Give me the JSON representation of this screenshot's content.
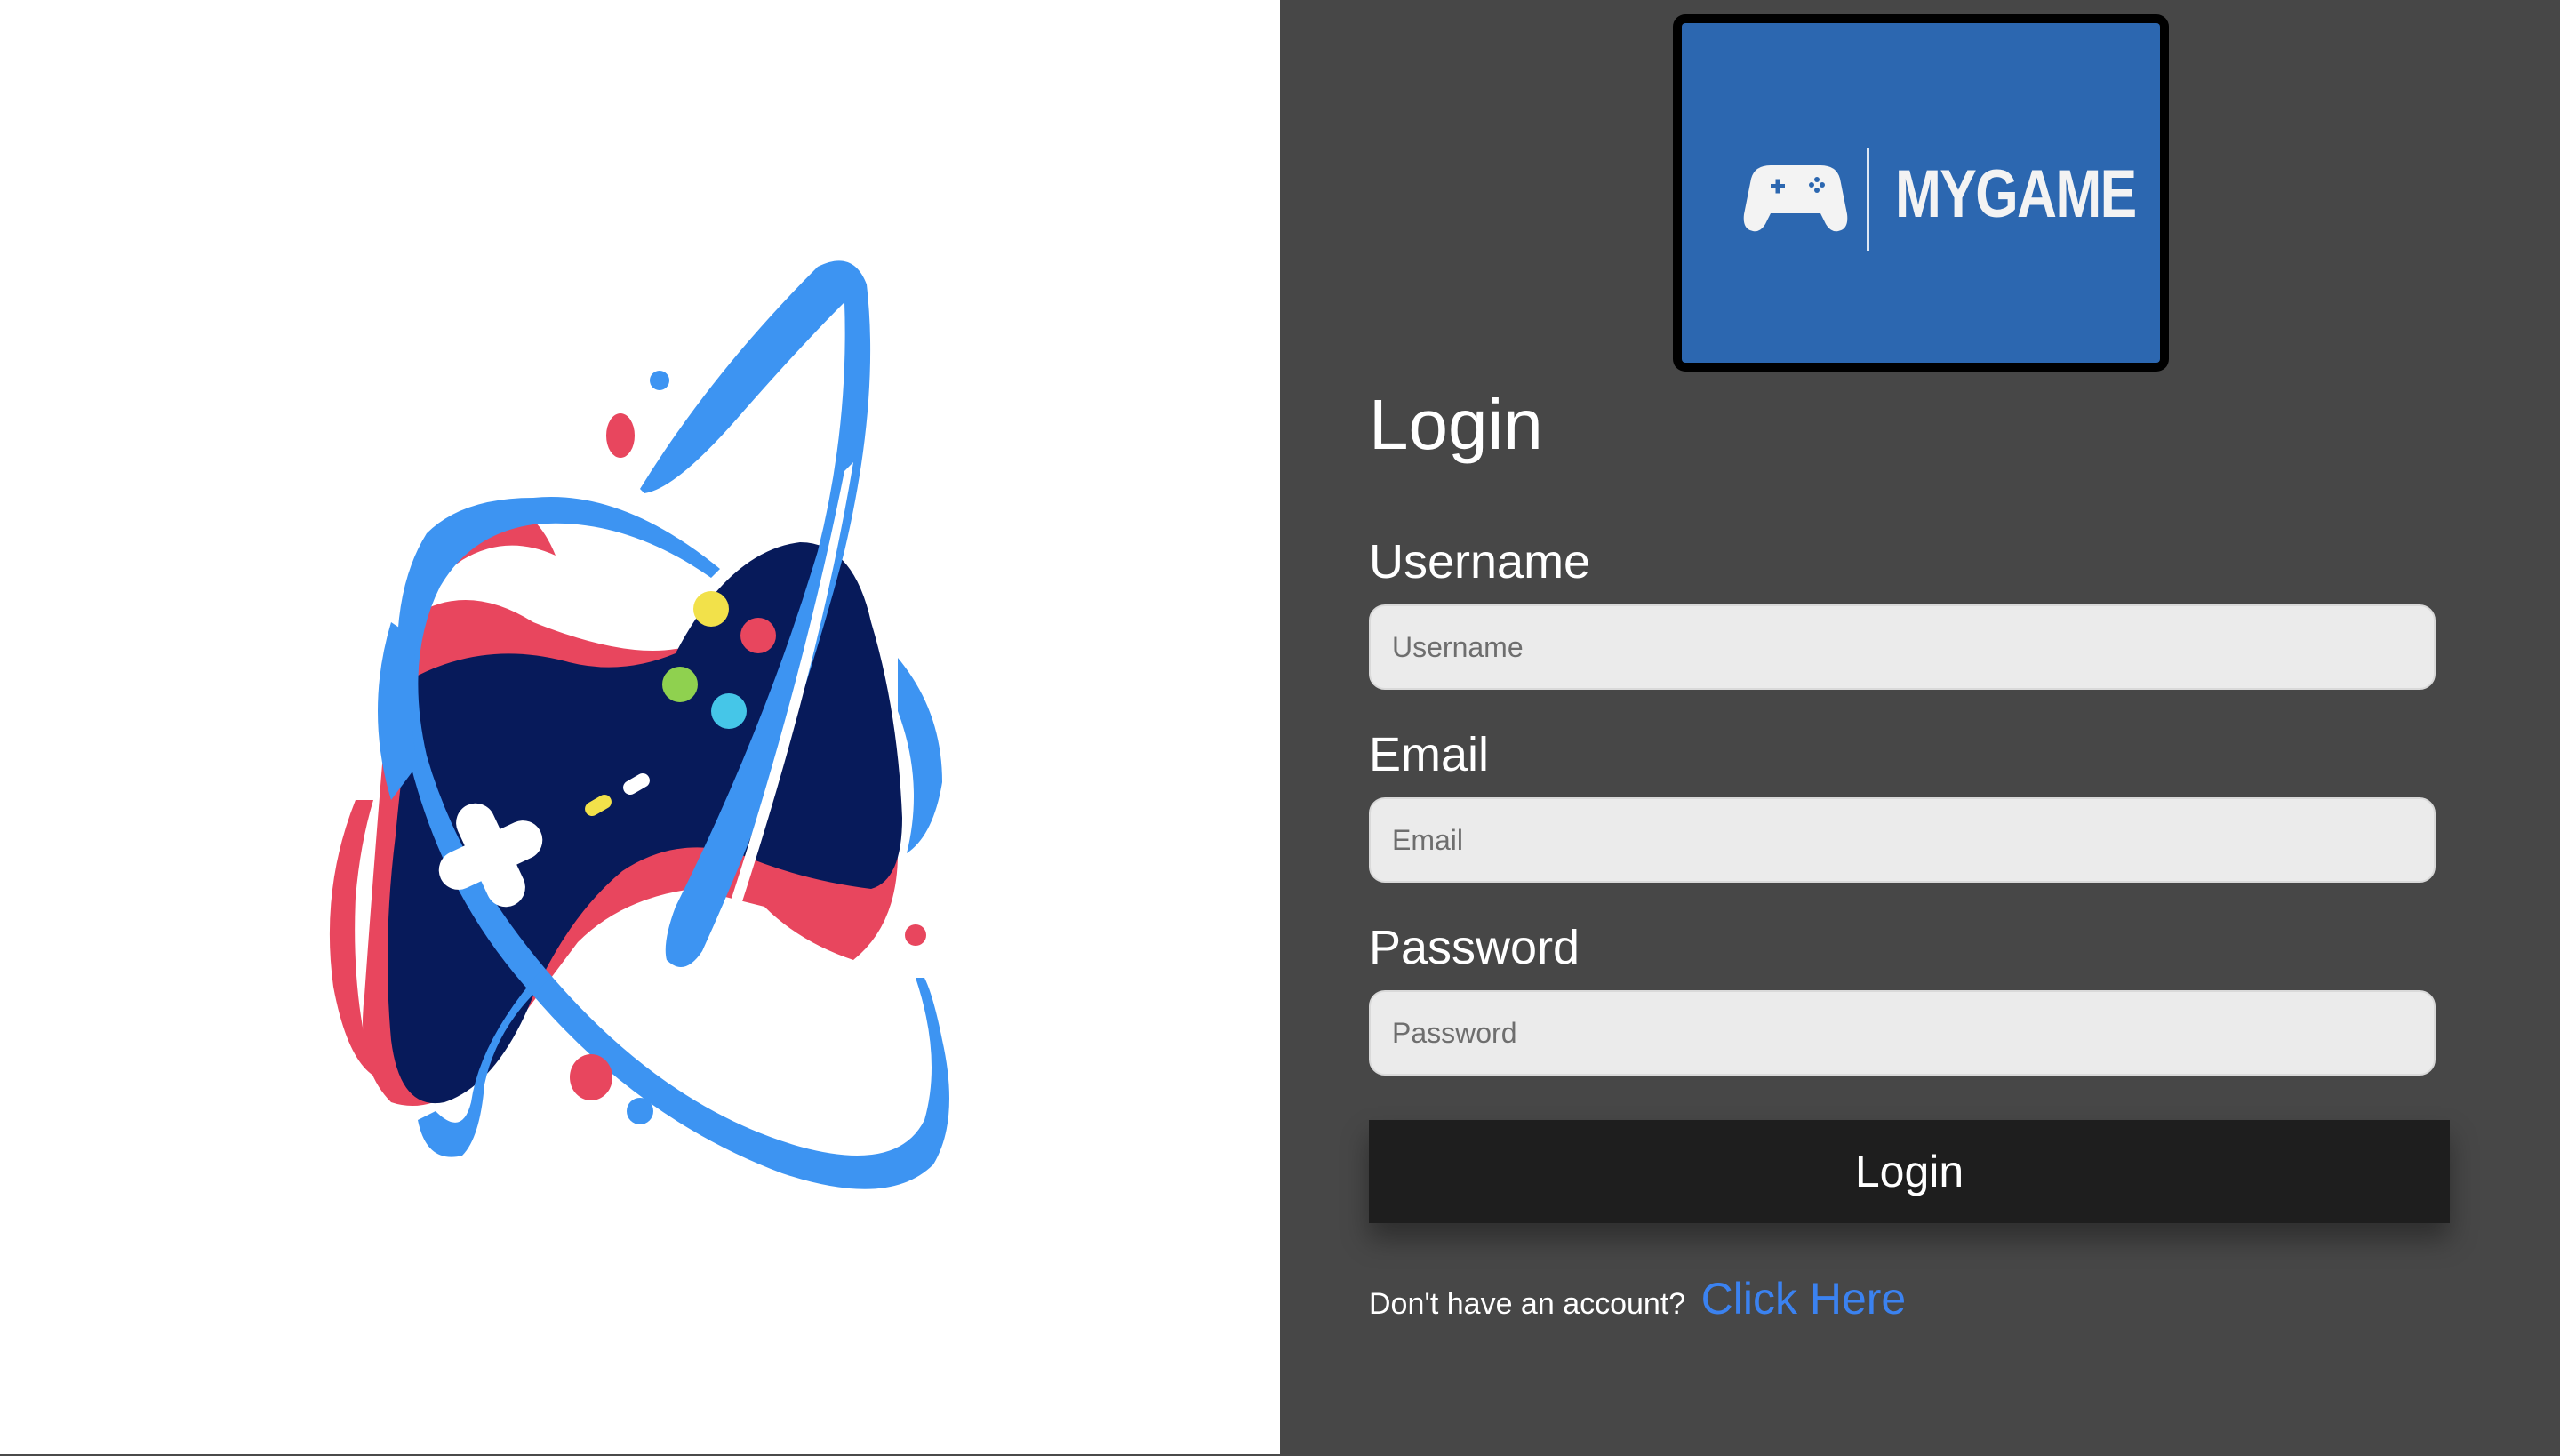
{
  "illustration": {
    "icon": "gamepad-illustration-icon"
  },
  "logo": {
    "icon": "gamepad-icon",
    "text": "MYGAME",
    "background_color": "#2c67b0"
  },
  "form": {
    "heading": "Login",
    "username": {
      "label": "Username",
      "placeholder": "Username"
    },
    "email": {
      "label": "Email",
      "placeholder": "Email"
    },
    "password": {
      "label": "Password",
      "placeholder": "Password"
    },
    "submit_label": "Login",
    "signup_prompt": "Don't have an account?",
    "signup_link": "Click Here"
  },
  "colors": {
    "panel_background": "#474747",
    "button_background": "#1e1e1e",
    "link": "#3b82f0",
    "illustration_blue": "#3d94f2",
    "illustration_navy": "#071a5a",
    "illustration_red": "#e8465e"
  }
}
